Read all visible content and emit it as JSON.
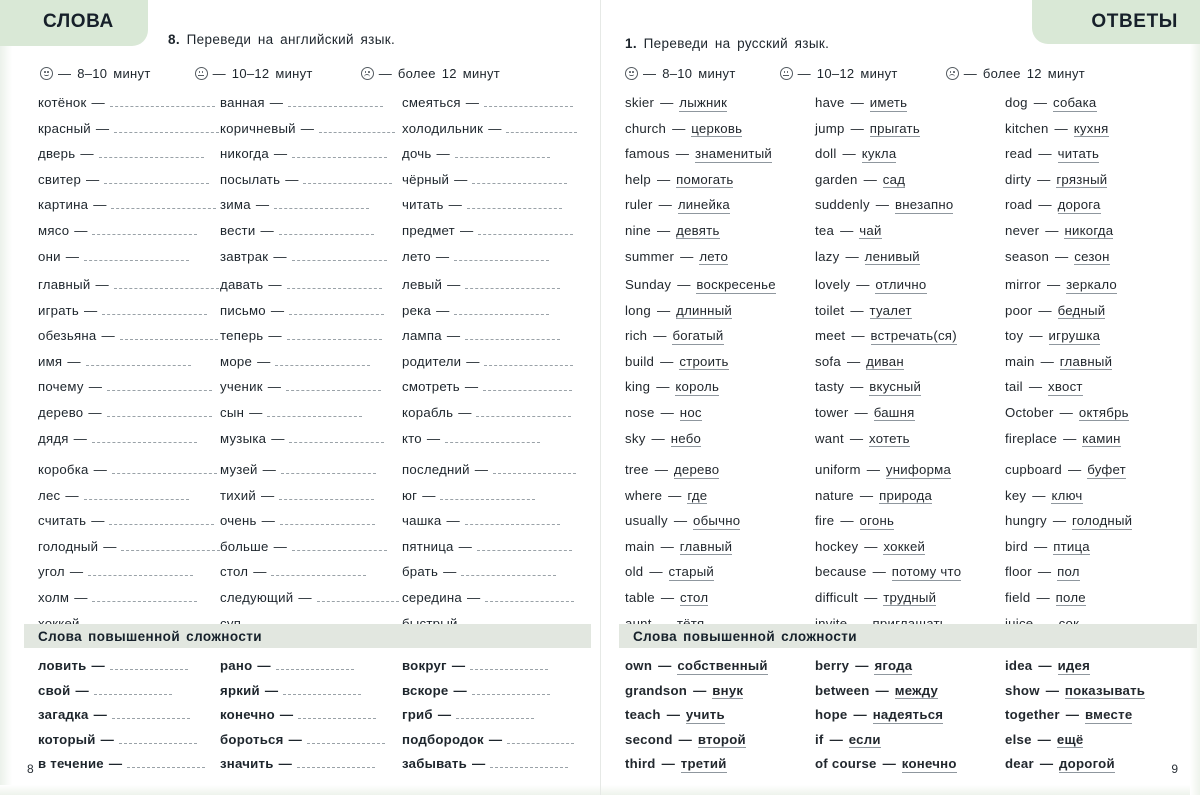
{
  "left_page": {
    "tab_label": "СЛОВА",
    "task_number": "8.",
    "task_text": "Переведи на английский язык.",
    "legend": [
      {
        "face": "happy",
        "text": "— 8–10 минут"
      },
      {
        "face": "neutral",
        "text": "— 10–12 минут"
      },
      {
        "face": "sad",
        "text": "— более 12 минут"
      }
    ],
    "blocks": [
      {
        "columns": [
          [
            "котёнок",
            "красный",
            "дверь",
            "свитер",
            "картина",
            "мясо",
            "они"
          ],
          [
            "ванная",
            "коричневый",
            "никогда",
            "посылать",
            "зима",
            "вести",
            "завтрак"
          ],
          [
            "смеяться",
            "холодильник",
            "дочь",
            "чёрный",
            "читать",
            "предмет",
            "лето"
          ]
        ]
      },
      {
        "columns": [
          [
            "главный",
            "играть",
            "обезьяна",
            "имя",
            "почему",
            "дерево",
            "дядя"
          ],
          [
            "давать",
            "письмо",
            "теперь",
            "море",
            "ученик",
            "сын",
            "музыка"
          ],
          [
            "левый",
            "река",
            "лампа",
            "родители",
            "смотреть",
            "корабль",
            "кто"
          ]
        ]
      },
      {
        "columns": [
          [
            "коробка",
            "лес",
            "считать",
            "голодный",
            "угол",
            "холм",
            "хоккей"
          ],
          [
            "музей",
            "тихий",
            "очень",
            "больше",
            "стол",
            "следующий",
            "суп"
          ],
          [
            "последний",
            "юг",
            "чашка",
            "пятница",
            "брать",
            "середина",
            "быстрый"
          ]
        ]
      }
    ],
    "hard_title": "Слова повышенной сложности",
    "hard_columns": [
      [
        "ловить",
        "свой",
        "загадка",
        "который",
        "в течение"
      ],
      [
        "рано",
        "яркий",
        "конечно",
        "бороться",
        "значить"
      ],
      [
        "вокруг",
        "вскоре",
        "гриб",
        "подбородок",
        "забывать"
      ]
    ],
    "page_number": "8"
  },
  "right_page": {
    "tab_label": "ОТВЕТЫ",
    "task_number": "1.",
    "task_text": "Переведи на русский язык.",
    "legend": [
      {
        "face": "happy",
        "text": "— 8–10 минут"
      },
      {
        "face": "neutral",
        "text": "— 10–12 минут"
      },
      {
        "face": "sad",
        "text": "— более 12 минут"
      }
    ],
    "blocks": [
      {
        "columns": [
          [
            [
              "skier",
              "лыжник"
            ],
            [
              "church",
              "церковь"
            ],
            [
              "famous",
              "знаменитый"
            ],
            [
              "help",
              "помогать"
            ],
            [
              "ruler",
              "линейка"
            ],
            [
              "nine",
              "девять"
            ],
            [
              "summer",
              "лето"
            ]
          ],
          [
            [
              "have",
              "иметь"
            ],
            [
              "jump",
              "прыгать"
            ],
            [
              "doll",
              "кукла"
            ],
            [
              "garden",
              "сад"
            ],
            [
              "suddenly",
              "внезапно"
            ],
            [
              "tea",
              "чай"
            ],
            [
              "lazy",
              "ленивый"
            ]
          ],
          [
            [
              "dog",
              "собака"
            ],
            [
              "kitchen",
              "кухня"
            ],
            [
              "read",
              "читать"
            ],
            [
              "dirty",
              "грязный"
            ],
            [
              "road",
              "дорога"
            ],
            [
              "never",
              "никогда"
            ],
            [
              "season",
              "сезон"
            ]
          ]
        ]
      },
      {
        "columns": [
          [
            [
              "Sunday",
              "воскресенье"
            ],
            [
              "long",
              "длинный"
            ],
            [
              "rich",
              "богатый"
            ],
            [
              "build",
              "строить"
            ],
            [
              "king",
              "король"
            ],
            [
              "nose",
              "нос"
            ],
            [
              "sky",
              "небо"
            ]
          ],
          [
            [
              "lovely",
              "отлично"
            ],
            [
              "toilet",
              "туалет"
            ],
            [
              "meet",
              "встречать(ся)"
            ],
            [
              "sofa",
              "диван"
            ],
            [
              "tasty",
              "вкусный"
            ],
            [
              "tower",
              "башня"
            ],
            [
              "want",
              "хотеть"
            ]
          ],
          [
            [
              "mirror",
              "зеркало"
            ],
            [
              "poor",
              "бедный"
            ],
            [
              "toy",
              "игрушка"
            ],
            [
              "main",
              "главный"
            ],
            [
              "tail",
              "хвост"
            ],
            [
              "October",
              "октябрь"
            ],
            [
              "fireplace",
              "камин"
            ]
          ]
        ]
      },
      {
        "columns": [
          [
            [
              "tree",
              "дерево"
            ],
            [
              "where",
              "где"
            ],
            [
              "usually",
              "обычно"
            ],
            [
              "main",
              "главный"
            ],
            [
              "old",
              "старый"
            ],
            [
              "table",
              "стол"
            ],
            [
              "aunt",
              "тётя"
            ]
          ],
          [
            [
              "uniform",
              "униформа"
            ],
            [
              "nature",
              "природа"
            ],
            [
              "fire",
              "огонь"
            ],
            [
              "hockey",
              "хоккей"
            ],
            [
              "because",
              "потому что"
            ],
            [
              "difficult",
              "трудный"
            ],
            [
              "invite",
              "приглашать"
            ]
          ],
          [
            [
              "cupboard",
              "буфет"
            ],
            [
              "key",
              "ключ"
            ],
            [
              "hungry",
              "голодный"
            ],
            [
              "bird",
              "птица"
            ],
            [
              "floor",
              "пол"
            ],
            [
              "field",
              "поле"
            ],
            [
              "juice",
              "сок"
            ]
          ]
        ]
      }
    ],
    "hard_title": "Слова повышенной сложности",
    "hard_columns": [
      [
        [
          "own",
          "собственный"
        ],
        [
          "grandson",
          "внук"
        ],
        [
          "teach",
          "учить"
        ],
        [
          "second",
          "второй"
        ],
        [
          "third",
          "третий"
        ]
      ],
      [
        [
          "berry",
          "ягода"
        ],
        [
          "between",
          "между"
        ],
        [
          "hope",
          "надеяться"
        ],
        [
          "if",
          "если"
        ],
        [
          "of course",
          "конечно"
        ]
      ],
      [
        [
          "idea",
          "идея"
        ],
        [
          "show",
          "показывать"
        ],
        [
          "together",
          "вместе"
        ],
        [
          "else",
          "ещё"
        ],
        [
          "dear",
          "дорогой"
        ]
      ]
    ],
    "page_number": "9"
  },
  "colors": {
    "tab_green": "#d9e8d6",
    "band_green": "#e2e7e0",
    "ink": "#1d252c",
    "blank_rule": "#9aa2a8"
  }
}
